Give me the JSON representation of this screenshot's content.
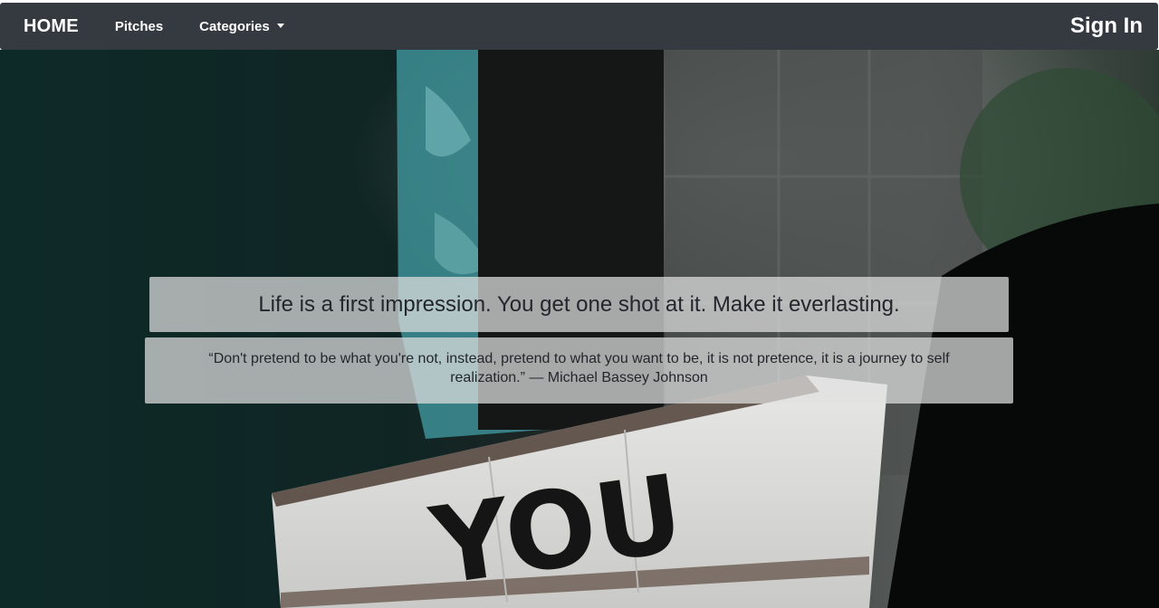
{
  "nav": {
    "brand": "HOME",
    "links": [
      {
        "label": "Pitches"
      },
      {
        "label": "Categories"
      }
    ],
    "sign_in": "Sign In"
  },
  "hero": {
    "headline": "Life is a first impression. You get one shot at it. Make it everlasting.",
    "quote": "“Don't pretend to be what you're not, instead, pretend to what you want to be, it is not pretence, it is a journey to self realization.” — Michael Bassey Johnson",
    "sign_text": "YOU"
  },
  "colors": {
    "navbar": "#343a40",
    "nav_text": "#ffffff",
    "quote_box": "rgba(225,225,225,0.72)"
  }
}
